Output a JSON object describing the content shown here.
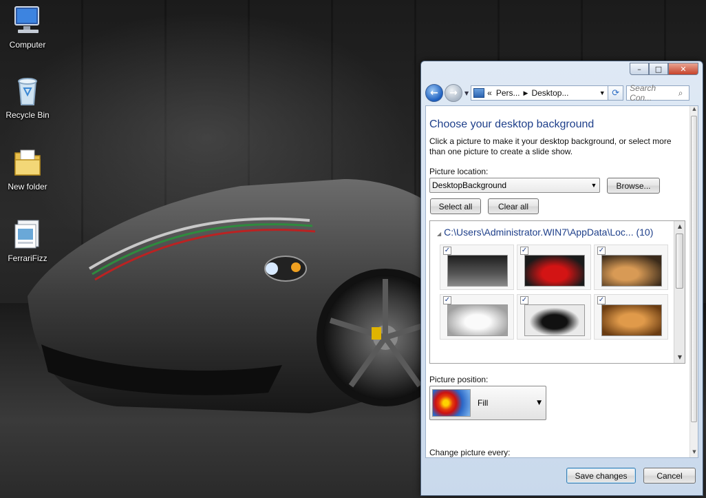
{
  "desktop": {
    "icons": [
      {
        "label": "Computer"
      },
      {
        "label": "Recycle Bin"
      },
      {
        "label": "New folder"
      },
      {
        "label": "FerrariFizz"
      }
    ]
  },
  "window": {
    "caption": {
      "minimize": "–",
      "maximize": "□",
      "close": "✕"
    },
    "address": {
      "chevron": "«",
      "crumb1": "Pers...",
      "crumb2": "Desktop..."
    },
    "search_placeholder": "Search Con...",
    "title": "Choose your desktop background",
    "description": "Click a picture to make it your desktop background, or select more than one picture to create a slide show.",
    "picture_location_label": "Picture location:",
    "picture_location_value": "DesktopBackground",
    "browse_label": "Browse...",
    "select_all_label": "Select all",
    "clear_all_label": "Clear all",
    "gallery_header": "C:\\Users\\Administrator.WIN7\\AppData\\Loc... (10)",
    "thumbnails": [
      {
        "checked": true,
        "colors": [
          "#2b2b2b",
          "#8a8a8a"
        ]
      },
      {
        "checked": true,
        "colors": [
          "#c20d0d",
          "#1a1a1a"
        ]
      },
      {
        "checked": true,
        "colors": [
          "#c38a4a",
          "#3a2a1a"
        ]
      },
      {
        "checked": true,
        "colors": [
          "#e6e6e6",
          "#9a9a9a"
        ]
      },
      {
        "checked": true,
        "colors": [
          "#f0f0f0",
          "#111111"
        ]
      },
      {
        "checked": true,
        "colors": [
          "#d38a3e",
          "#7a4a1a"
        ]
      }
    ],
    "picture_position_label": "Picture position:",
    "picture_position_value": "Fill",
    "change_picture_label": "Change picture every:",
    "save_label": "Save changes",
    "cancel_label": "Cancel"
  }
}
